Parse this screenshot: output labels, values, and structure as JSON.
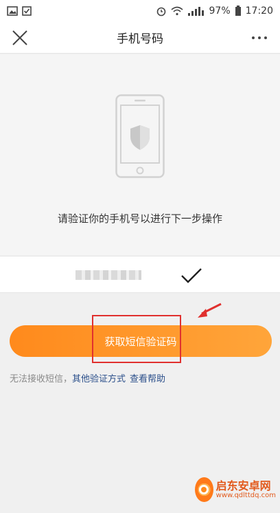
{
  "status_bar": {
    "battery": "97%",
    "time": "17:20"
  },
  "header": {
    "title": "手机号码"
  },
  "hero": {
    "instruction": "请验证你的手机号以进行下一步操作"
  },
  "phone_row": {
    "number_masked": true
  },
  "actions": {
    "sms_button_label": "获取短信验证码"
  },
  "help": {
    "no_sms_text": "无法接收短信，",
    "other_methods_link": "其他验证方式",
    "view_help_link": "查看帮助"
  },
  "watermark": {
    "site_name": "启东安卓网",
    "url": "www.qdlttdq.com"
  },
  "colors": {
    "accent_orange": "#ff9a2a",
    "link_blue": "#2b4f8a",
    "annotation_red": "#e0302e"
  }
}
